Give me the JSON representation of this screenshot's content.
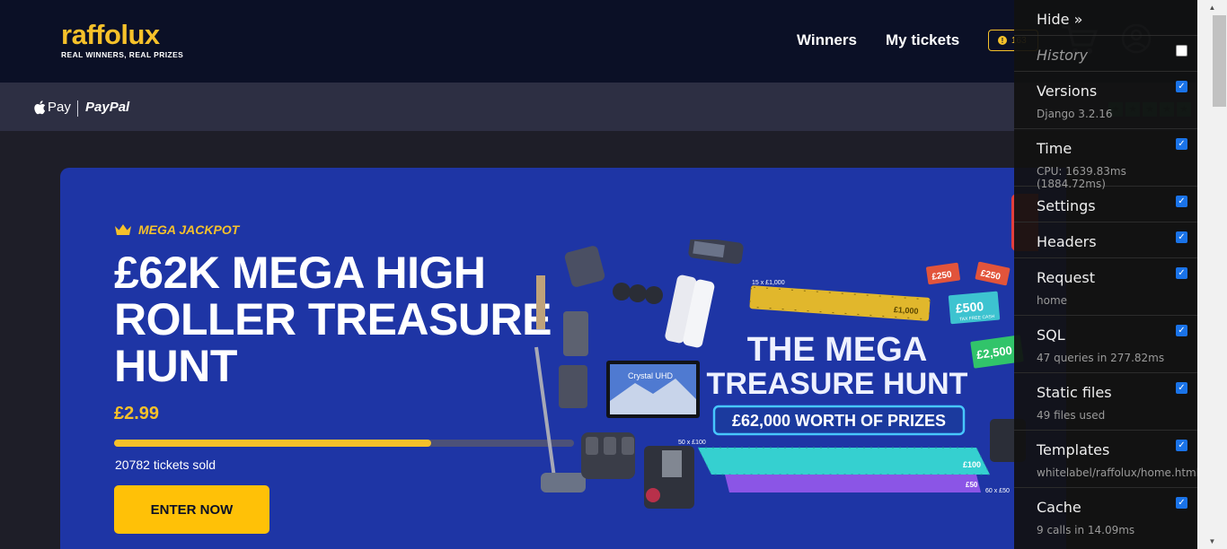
{
  "header": {
    "logo_word": "raffolux",
    "logo_tagline": "REAL WINNERS, REAL PRIZES",
    "nav": [
      "Winners",
      "My tickets"
    ],
    "coin_balance": "163"
  },
  "payments": {
    "apple_pay": "Pay",
    "paypal": "PayPal"
  },
  "hero": {
    "badge": "MEGA JACKPOT",
    "title": "£62K MEGA HIGH ROLLER TREASURE HUNT",
    "price": "£2.99",
    "progress_fraction": 0.69,
    "tickets_sold": "20782 tickets sold",
    "cta": "ENTER NOW",
    "art": {
      "headline_1": "THE MEGA",
      "headline_2": "TREASURE HUNT",
      "prize_total": "£62,000 WORTH OF PRIZES",
      "tv_label": "Crystal UHD",
      "label_15x": "15 x £1,000",
      "label_50x": "50 x £100",
      "label_60x": "60 x £50",
      "ticket_250": "£250",
      "ticket_500": "£500",
      "ticket_2500": "£2,500",
      "ticket_1000": "£1,000",
      "ticket_100": "£100",
      "ticket_50": "£50",
      "tax_free": "TAX FREE CASH"
    }
  },
  "debug_toolbar": {
    "hide": "Hide »",
    "panels": [
      {
        "title": "History",
        "sub": "",
        "checked": false
      },
      {
        "title": "Versions",
        "sub": "Django 3.2.16",
        "checked": true
      },
      {
        "title": "Time",
        "sub": "CPU: 1639.83ms (1884.72ms)",
        "checked": true
      },
      {
        "title": "Settings",
        "sub": "",
        "checked": true
      },
      {
        "title": "Headers",
        "sub": "",
        "checked": true
      },
      {
        "title": "Request",
        "sub": "home",
        "checked": true
      },
      {
        "title": "SQL",
        "sub": "47 queries in 277.82ms",
        "checked": true
      },
      {
        "title": "Static files",
        "sub": "49 files used",
        "checked": true
      },
      {
        "title": "Templates",
        "sub": "whitelabel/raffolux/home.html",
        "checked": true
      },
      {
        "title": "Cache",
        "sub": "9 calls in 14.09ms",
        "checked": true
      }
    ]
  },
  "colors": {
    "brand_yellow": "#f6c12a",
    "header_bg": "#0b1026",
    "hero_bg": "#1e35a5"
  }
}
